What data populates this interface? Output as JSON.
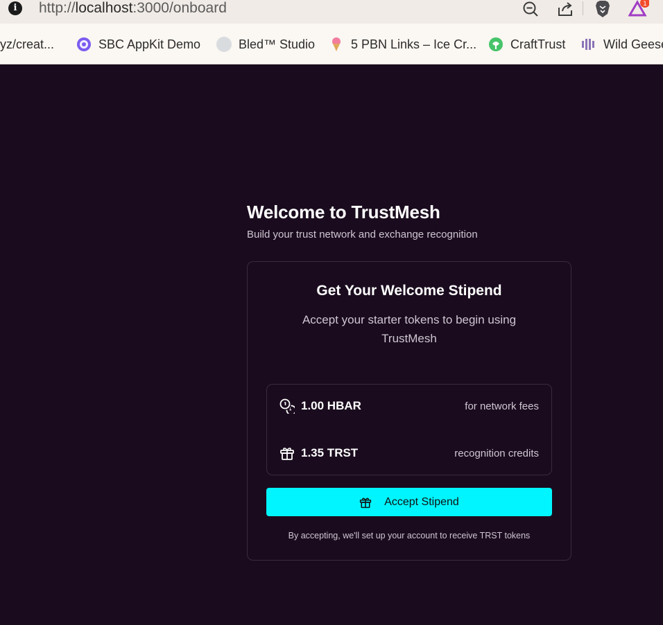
{
  "browser": {
    "url_scheme": "http://",
    "url_host": "localhost",
    "url_path": ":3000/onboard",
    "notification_count": "1",
    "bookmarks": [
      {
        "label": "yz/creat...",
        "icon": "none"
      },
      {
        "label": "SBC AppKit Demo",
        "icon": "purple-circle-icon"
      },
      {
        "label": "Bled™ Studio",
        "icon": "gray-circle-icon"
      },
      {
        "label": "5 PBN Links – Ice Cr...",
        "icon": "ice-cream-icon"
      },
      {
        "label": "CraftTrust",
        "icon": "craft-trust-icon"
      },
      {
        "label": "Wild Geese",
        "icon": "wild-geese-icon"
      }
    ]
  },
  "page": {
    "title": "Welcome to TrustMesh",
    "subtitle": "Build your trust network and exchange recognition"
  },
  "card": {
    "title": "Get Your Welcome Stipend",
    "description": "Accept your starter tokens to begin using TrustMesh",
    "rewards": [
      {
        "amount": "1.00 HBAR",
        "description": "for network fees",
        "icon": "coins-icon"
      },
      {
        "amount": "1.35 TRST",
        "description": "recognition credits",
        "icon": "gift-icon"
      }
    ],
    "button_label": "Accept Stipend",
    "footnote": "By accepting, we'll set up your account to receive TRST tokens"
  },
  "colors": {
    "background": "#1a0c1e",
    "accent": "#00f5ff",
    "border": "#3a2c3e"
  }
}
